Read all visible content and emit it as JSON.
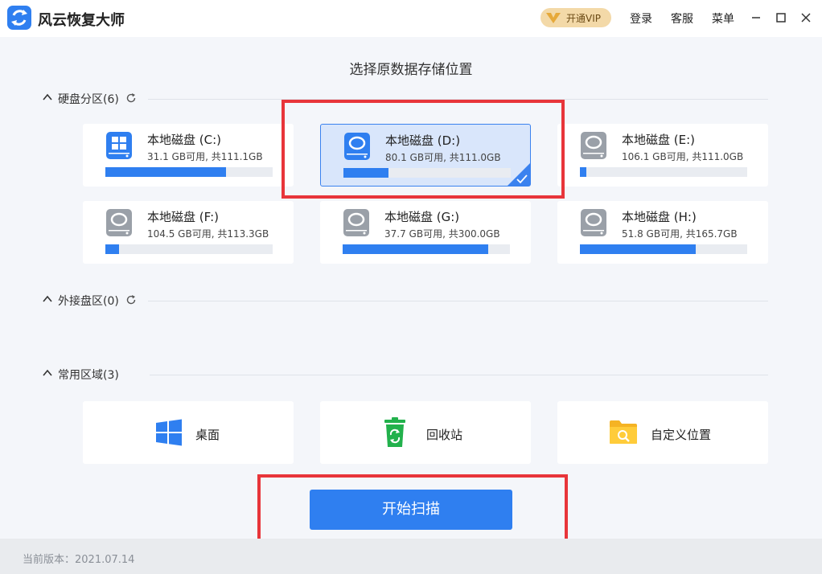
{
  "app": {
    "title": "风云恢复大师"
  },
  "header": {
    "vip_label": "开通VIP",
    "login": "登录",
    "service": "客服",
    "menu": "菜单"
  },
  "page": {
    "title": "选择原数据存储位置"
  },
  "sections": {
    "disks": {
      "label": "硬盘分区(6)"
    },
    "external": {
      "label": "外接盘区(0)"
    },
    "common": {
      "label": "常用区域(3)"
    }
  },
  "disks": [
    {
      "name": "本地磁盘 (C:)",
      "space": "31.1 GB可用, 共111.1GB",
      "used_fraction": 0.72,
      "icon": "windows-drive-icon"
    },
    {
      "name": "本地磁盘 (D:)",
      "space": "80.1 GB可用, 共111.0GB",
      "used_fraction": 0.27,
      "icon": "hard-drive-icon",
      "selected": true
    },
    {
      "name": "本地磁盘 (E:)",
      "space": "106.1 GB可用, 共111.0GB",
      "used_fraction": 0.04,
      "icon": "hard-drive-icon"
    },
    {
      "name": "本地磁盘 (F:)",
      "space": "104.5 GB可用, 共113.3GB",
      "used_fraction": 0.08,
      "icon": "hard-drive-icon"
    },
    {
      "name": "本地磁盘 (G:)",
      "space": "37.7 GB可用, 共300.0GB",
      "used_fraction": 0.87,
      "icon": "hard-drive-icon"
    },
    {
      "name": "本地磁盘 (H:)",
      "space": "51.8 GB可用, 共165.7GB",
      "used_fraction": 0.69,
      "icon": "hard-drive-icon"
    }
  ],
  "areas": [
    {
      "label": "桌面",
      "icon": "windows-logo-icon"
    },
    {
      "label": "回收站",
      "icon": "recycle-bin-icon"
    },
    {
      "label": "自定义位置",
      "icon": "folder-search-icon"
    }
  ],
  "actions": {
    "start_scan": "开始扫描"
  },
  "footer": {
    "version": "当前版本：2021.07.14"
  },
  "colors": {
    "accent": "#2f7ff0",
    "highlight": "#e8353a",
    "vip": "#f3d9a8"
  }
}
